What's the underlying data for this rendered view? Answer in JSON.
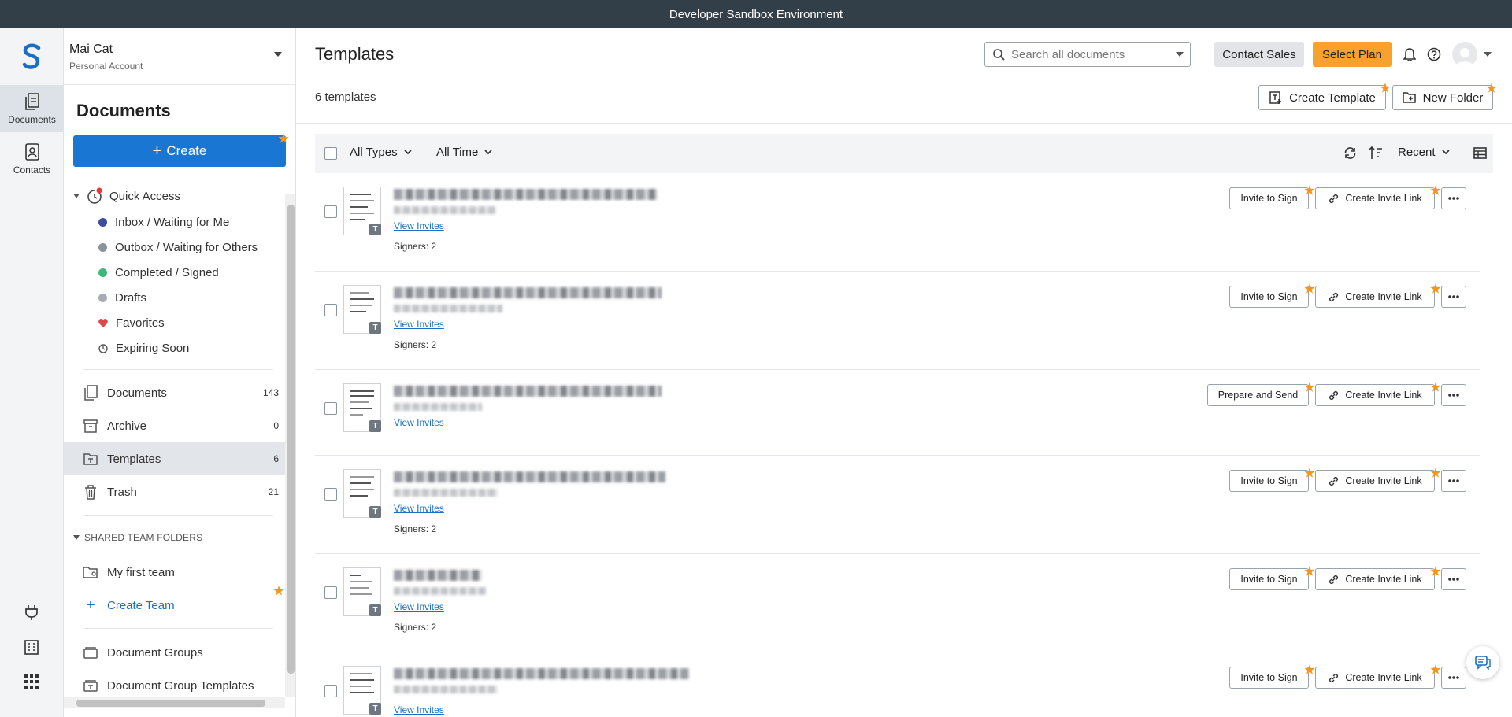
{
  "banner": "Developer Sandbox Environment",
  "rail": {
    "items": [
      {
        "label": "Documents",
        "icon": "documents-icon"
      },
      {
        "label": "Contacts",
        "icon": "contacts-icon"
      }
    ]
  },
  "account": {
    "name": "Mai Cat",
    "sub": "Personal Account"
  },
  "sidebar": {
    "title": "Documents",
    "create_label": "Create",
    "quick_access": "Quick Access",
    "qa_items": [
      {
        "label": "Inbox / Waiting for Me",
        "color": "#3b4f9e"
      },
      {
        "label": "Outbox / Waiting for Others",
        "color": "#8a939c"
      },
      {
        "label": "Completed / Signed",
        "color": "#3cb878"
      },
      {
        "label": "Drafts",
        "color": "#a7adb3"
      },
      {
        "label": "Favorites",
        "icon": "heart-icon",
        "color": "#e04848"
      },
      {
        "label": "Expiring Soon",
        "icon": "clock-icon"
      }
    ],
    "folders": [
      {
        "label": "Documents",
        "count": "143"
      },
      {
        "label": "Archive",
        "count": "0"
      },
      {
        "label": "Templates",
        "count": "6"
      },
      {
        "label": "Trash",
        "count": "21"
      }
    ],
    "shared_header": "SHARED TEAM FOLDERS",
    "team": "My first team",
    "create_team": "Create Team",
    "groups": "Document Groups",
    "group_templates": "Document Group Templates"
  },
  "header": {
    "title": "Templates",
    "search_placeholder": "Search all documents",
    "contact_sales": "Contact Sales",
    "select_plan": "Select Plan",
    "count": "6 templates",
    "create_template": "Create Template",
    "new_folder": "New Folder"
  },
  "toolbar": {
    "type_filter": "All Types",
    "time_filter": "All Time",
    "sort": "Recent"
  },
  "rows": [
    {
      "primary": "Invite to Sign",
      "secondary": "Create Invite Link",
      "view": "View Invites",
      "signers": "Signers: 2"
    },
    {
      "primary": "Invite to Sign",
      "secondary": "Create Invite Link",
      "view": "View Invites",
      "signers": "Signers: 2"
    },
    {
      "primary": "Prepare and Send",
      "secondary": "Create Invite Link",
      "view": "View Invites",
      "signers": ""
    },
    {
      "primary": "Invite to Sign",
      "secondary": "Create Invite Link",
      "view": "View Invites",
      "signers": "Signers: 2"
    },
    {
      "primary": "Invite to Sign",
      "secondary": "Create Invite Link",
      "view": "View Invites",
      "signers": "Signers: 2"
    },
    {
      "primary": "Invite to Sign",
      "secondary": "Create Invite Link",
      "view": "View Invites",
      "signers": ""
    }
  ],
  "badge_letter": "T",
  "colors": {
    "accent": "#1976d2",
    "orange": "#f9a12e",
    "banner": "#323e48"
  }
}
